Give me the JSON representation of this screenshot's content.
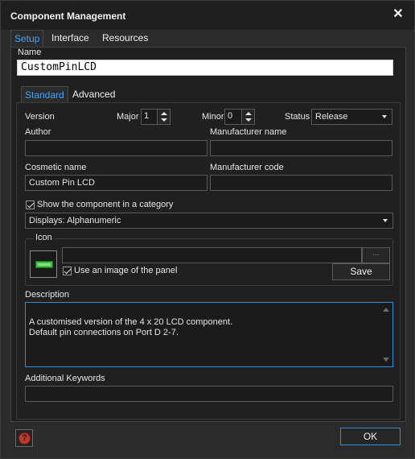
{
  "window": {
    "title": "Component Management",
    "close_glyph": "✕"
  },
  "top_tabs": [
    {
      "label": "Setup",
      "active": true
    },
    {
      "label": "Interface",
      "active": false
    },
    {
      "label": "Resources",
      "active": false
    }
  ],
  "name": {
    "label": "Name",
    "value": "CustomPinLCD"
  },
  "inner_tabs": [
    {
      "label": "Standard",
      "active": true
    },
    {
      "label": "Advanced",
      "active": false
    }
  ],
  "version": {
    "label": "Version",
    "major_label": "Major",
    "major_value": "1",
    "minor_label": "Minor",
    "minor_value": "0"
  },
  "status": {
    "label": "Status",
    "value": "Release"
  },
  "author": {
    "label": "Author",
    "value": ""
  },
  "manufacturer_name": {
    "label": "Manufacturer name",
    "value": ""
  },
  "cosmetic_name": {
    "label": "Cosmetic name",
    "value": "Custom Pin LCD"
  },
  "manufacturer_code": {
    "label": "Manufacturer code",
    "value": ""
  },
  "category": {
    "checkbox_label": "Show the component in a category",
    "checked": true,
    "value": "Displays: Alphanumeric"
  },
  "icon_group": {
    "title": "Icon",
    "path_value": "",
    "browse_label": "...",
    "use_image_label": "Use an image of the panel",
    "use_image_checked": true,
    "save_label": "Save"
  },
  "description": {
    "label": "Description",
    "value": "A customised version of the 4 x 20 LCD component.\nDefault pin connections on Port D 2-7."
  },
  "keywords": {
    "label": "Additional Keywords",
    "value": ""
  },
  "footer": {
    "ok_label": "OK"
  },
  "colors": {
    "accent": "#3ea6ff",
    "focus_border": "#2f8ed8",
    "background": "#2b2b2b",
    "panel": "#202020"
  },
  "icons": {
    "help": "help-icon",
    "close": "close-icon",
    "component": "lcd-component-icon"
  }
}
